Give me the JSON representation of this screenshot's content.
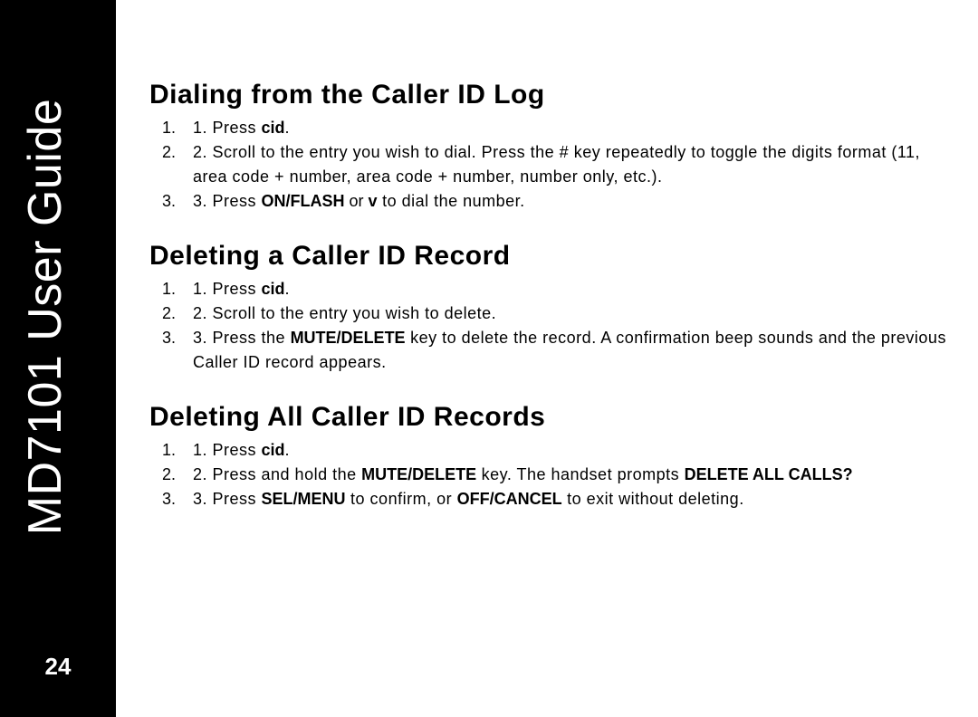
{
  "sidebar": {
    "title": "MD7101 User Guide",
    "page_number": "24"
  },
  "sections": [
    {
      "heading": "Dialing from the Caller ID Log",
      "items": [
        {
          "pre": "1.  Press ",
          "bold1": "cid",
          "post1": "."
        },
        {
          "pre": "2.  Scroll to the entry you wish to dial. Press the # key repeatedly to toggle the digits format (11, area code + number, area code + number, number only, etc.)."
        },
        {
          "pre": "3.  Press ",
          "bold1": "ON/FLASH",
          "mid1": " or ",
          "bold2": "v",
          "post1": "  to dial the number."
        }
      ]
    },
    {
      "heading": "Deleting a Caller ID Record",
      "items": [
        {
          "pre": "1.  Press ",
          "bold1": "cid",
          "post1": "."
        },
        {
          "pre": "2.  Scroll to the entry you wish to delete."
        },
        {
          "pre": "3.  Press the ",
          "bold1": "MUTE/DELETE",
          "post1": " key to delete the record. A confirmation beep sounds and the previous Caller ID record appears."
        }
      ]
    },
    {
      "heading": "Deleting All Caller ID Records",
      "items": [
        {
          "pre": "1.  Press ",
          "bold1": "cid",
          "post1": "."
        },
        {
          "pre": "2.  Press and hold the ",
          "bold1": "MUTE/DELETE",
          "mid1": " key. The handset prompts ",
          "bold2": "DELETE ALL CALLS?"
        },
        {
          "pre": "3.  Press ",
          "bold1": "SEL/MENU",
          "mid1": " to confirm, or ",
          "bold2": "OFF/CANCEL",
          "post1": " to exit without deleting."
        }
      ]
    }
  ]
}
